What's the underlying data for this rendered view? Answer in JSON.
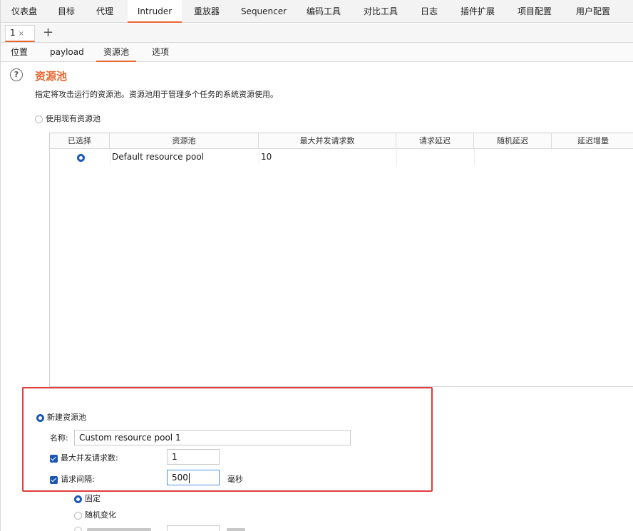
{
  "top_tabs": [
    "仪表盘",
    "目标",
    "代理",
    "Intruder",
    "重放器",
    "Sequencer",
    "编码工具",
    "对比工具",
    "日志",
    "插件扩展",
    "项目配置",
    "用户配置"
  ],
  "instance_tab": {
    "label": "1",
    "close": "×",
    "add": "+"
  },
  "sub_tabs": [
    "位置",
    "payload",
    "资源池",
    "选项"
  ],
  "section": {
    "title": "资源池",
    "description": "指定将攻击运行的资源池。资源池用于管理多个任务的系统资源使用。"
  },
  "use_existing_label": "使用现有资源池",
  "table": {
    "headers": [
      "已选择",
      "资源池",
      "最大并发请求数",
      "请求延迟",
      "随机延迟",
      "延迟增量"
    ],
    "rows": [
      {
        "selected": true,
        "name": "Default resource pool",
        "max_concurrent": "10",
        "request_delay": "",
        "random_delay": "",
        "delay_increment": ""
      }
    ]
  },
  "new_pool": {
    "label": "新建资源池",
    "name_label": "名称:",
    "name_value": "Custom resource pool 1",
    "max_concurrent_label": "最大并发请求数:",
    "max_concurrent_value": "1",
    "max_concurrent_checked": true,
    "delay_label": "请求间隔:",
    "delay_value": "500",
    "delay_checked": true,
    "delay_unit": "毫秒"
  },
  "delay_modes": [
    "固定",
    "随机变化"
  ],
  "colors": {
    "accent": "#e8672f",
    "highlight": "#e23b3b",
    "selected": "#1c57b5"
  }
}
